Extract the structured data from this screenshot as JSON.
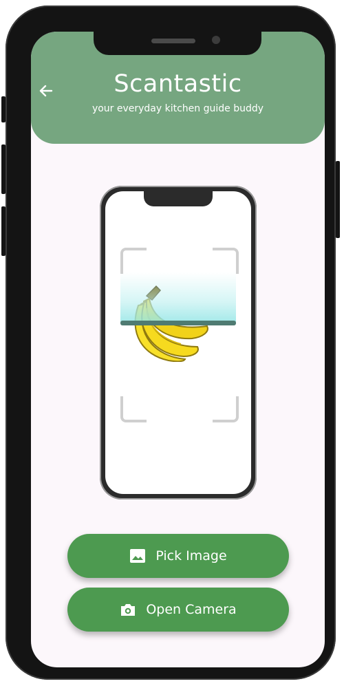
{
  "header": {
    "back_icon": "arrow-left-icon",
    "title": "Scantastic",
    "subtitle": "your everyday kitchen guide buddy"
  },
  "illustration": {
    "icon": "banana-icon",
    "scanner_color": "#4f7b72"
  },
  "actions": {
    "pick_image": {
      "label": "Pick Image",
      "icon": "image-icon"
    },
    "open_camera": {
      "label": "Open Camera",
      "icon": "camera-icon"
    }
  },
  "colors": {
    "header_bg": "#76a680",
    "button_bg": "#4d9a50",
    "screen_bg": "#fcf7fb"
  }
}
